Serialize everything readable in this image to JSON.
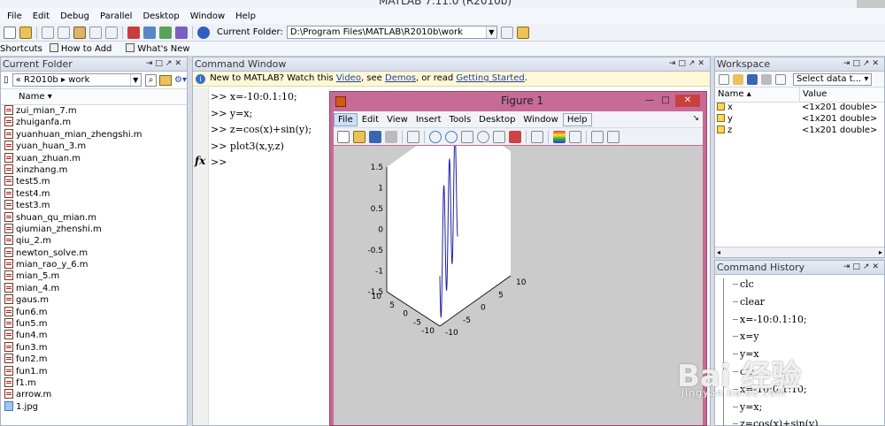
{
  "window": {
    "title": "MATLAB 7.11.0 (R2010b)"
  },
  "menubar": {
    "items": [
      "File",
      "Edit",
      "Debug",
      "Parallel",
      "Desktop",
      "Window",
      "Help"
    ]
  },
  "toolbar": {
    "current_folder_label": "Current Folder:",
    "current_folder_value": "D:\\Program Files\\MATLAB\\R2010b\\work"
  },
  "shortcuts": {
    "items": [
      "Shortcuts",
      "How to Add",
      "What's New"
    ]
  },
  "current_folder": {
    "title": "Current Folder",
    "path_prefix": "«",
    "path_segments": [
      "R2010b",
      "work"
    ],
    "col_name": "Name",
    "files": [
      "zui_mian_7.m",
      "zhuiganfa.m",
      "yuanhuan_mian_zhengshi.m",
      "yuan_huan_3.m",
      "xuan_zhuan.m",
      "xinzhang.m",
      "test5.m",
      "test4.m",
      "test3.m",
      "shuan_qu_mian.m",
      "qiumian_zhenshi.m",
      "qiu_2.m",
      "newton_solve.m",
      "mian_rao_y_6.m",
      "mian_5.m",
      "mian_4.m",
      "gaus.m",
      "fun6.m",
      "fun5.m",
      "fun4.m",
      "fun3.m",
      "fun2.m",
      "fun1.m",
      "f1.m",
      "arrow.m",
      "1.jpg"
    ]
  },
  "command_window": {
    "title": "Command Window",
    "info": {
      "prefix": "New to MATLAB? Watch this ",
      "video": "Video",
      "see": ", see ",
      "demos": "Demos",
      "or": ", or read ",
      "getting_started": "Getting Started",
      "end": "."
    },
    "lines": [
      ">> x=-10:0.1:10;",
      ">> y=x;",
      ">> z=cos(x)+sin(y);",
      ">> plot3(x,y,z)"
    ],
    "fx": "fx",
    "prompt": ">>"
  },
  "figure": {
    "title": "Figure 1",
    "menu": [
      "File",
      "Edit",
      "View",
      "Insert",
      "Tools",
      "Desktop",
      "Window",
      "Help"
    ],
    "active_menu": "File"
  },
  "chart_data": {
    "type": "line",
    "projection": "3d",
    "z_ticks": [
      "1.5",
      "1",
      "0.5",
      "0",
      "-0.5",
      "-1",
      "-1.5"
    ],
    "y_ticks": [
      "10",
      "5",
      "0",
      "-5",
      "-10"
    ],
    "x_ticks": [
      "-10",
      "-5",
      "0",
      "5",
      "10"
    ],
    "zlim": [
      -1.5,
      1.5
    ],
    "xlim": [
      -10,
      10
    ],
    "ylim": [
      -10,
      10
    ],
    "x_start": -10,
    "x_end": 10,
    "x_step": 0.1,
    "series": [
      {
        "x_expr": "x",
        "y_expr": "y=x",
        "z_expr": "z=cos(x)+sin(y)",
        "color": "#1f1fa8"
      }
    ],
    "grid": false
  },
  "workspace": {
    "title": "Workspace",
    "select_label": "Select data t...",
    "col_name": "Name",
    "col_value": "Value",
    "vars": [
      {
        "name": "x",
        "value": "<1x201 double>"
      },
      {
        "name": "y",
        "value": "<1x201 double>"
      },
      {
        "name": "z",
        "value": "<1x201 double>"
      }
    ]
  },
  "history": {
    "title": "Command History",
    "items": [
      "clc",
      "clear",
      "x=-10:0.1:10;",
      "x=y",
      "y=x",
      "clc",
      "x=-10:0.1:10;",
      "y=x;",
      "z=cos(x)+sin(y)"
    ]
  },
  "watermark": {
    "logo": "Bai 经验",
    "url": "jingyan.baidu.com"
  }
}
